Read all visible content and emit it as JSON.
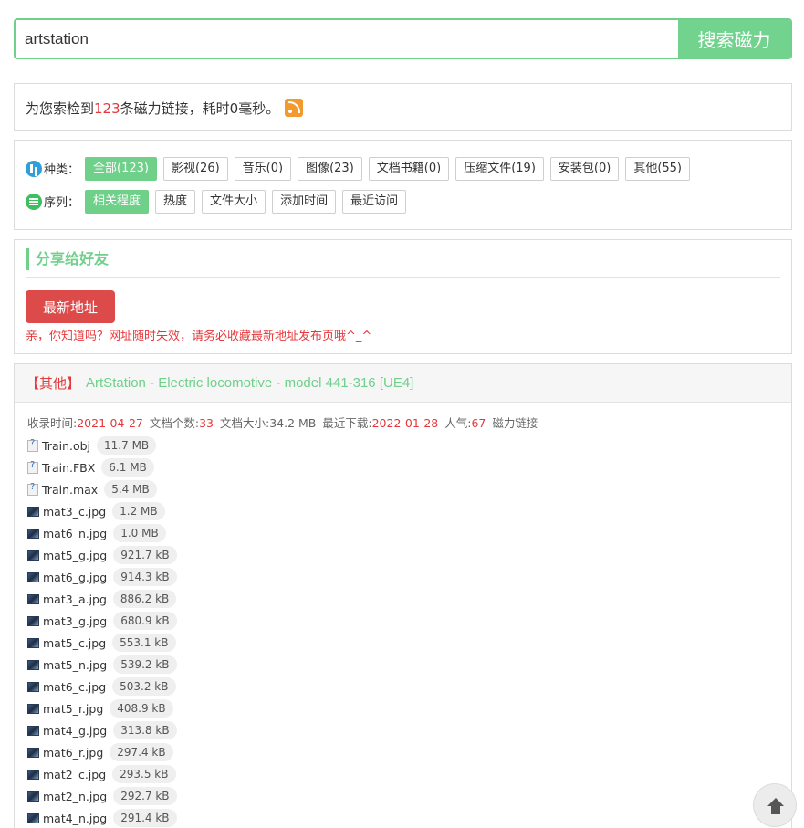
{
  "search": {
    "query": "artstation",
    "button_label": "搜索磁力"
  },
  "summary": {
    "prefix": "为您索检到",
    "count": "123",
    "suffix": "条磁力链接，耗时0毫秒。"
  },
  "filters": {
    "kind_label": "种类：",
    "kinds": [
      "全部(123)",
      "影视(26)",
      "音乐(0)",
      "图像(23)",
      "文档书籍(0)",
      "压缩文件(19)",
      "安装包(0)",
      "其他(55)"
    ],
    "sort_label": "序列：",
    "sorts": [
      "相关程度",
      "热度",
      "文件大小",
      "添加时间",
      "最近访问"
    ]
  },
  "share": {
    "title": "分享给好友",
    "button_label": "最新地址",
    "notice": "亲，你知道吗？网址随时失效，请务必收藏最新地址发布页哦^_^"
  },
  "result": {
    "category": "【其他】",
    "title": "ArtStation - Electric locomotive - model 441-316 [UE4]",
    "meta": {
      "date_label": "收录时间:",
      "date": "2021-04-27",
      "files_label": "文档个数:",
      "files": "33",
      "size_label": "文档大小:",
      "size": "34.2 MB",
      "last_label": "最近下载:",
      "last": "2022-01-28",
      "pop_label": "人气:",
      "pop": "67",
      "magnet_label": "磁力链接"
    },
    "files": [
      {
        "name": "Train.obj",
        "size": "11.7 MB",
        "icon": "unknown-file-icon"
      },
      {
        "name": "Train.FBX",
        "size": "6.1 MB",
        "icon": "unknown-file-icon"
      },
      {
        "name": "Train.max",
        "size": "5.4 MB",
        "icon": "unknown-file-icon"
      },
      {
        "name": "mat3_c.jpg",
        "size": "1.2 MB",
        "icon": "image-file-icon"
      },
      {
        "name": "mat6_n.jpg",
        "size": "1.0 MB",
        "icon": "image-file-icon"
      },
      {
        "name": "mat5_g.jpg",
        "size": "921.7 kB",
        "icon": "image-file-icon"
      },
      {
        "name": "mat6_g.jpg",
        "size": "914.3 kB",
        "icon": "image-file-icon"
      },
      {
        "name": "mat3_a.jpg",
        "size": "886.2 kB",
        "icon": "image-file-icon"
      },
      {
        "name": "mat3_g.jpg",
        "size": "680.9 kB",
        "icon": "image-file-icon"
      },
      {
        "name": "mat5_c.jpg",
        "size": "553.1 kB",
        "icon": "image-file-icon"
      },
      {
        "name": "mat5_n.jpg",
        "size": "539.2 kB",
        "icon": "image-file-icon"
      },
      {
        "name": "mat6_c.jpg",
        "size": "503.2 kB",
        "icon": "image-file-icon"
      },
      {
        "name": "mat5_r.jpg",
        "size": "408.9 kB",
        "icon": "image-file-icon"
      },
      {
        "name": "mat4_g.jpg",
        "size": "313.8 kB",
        "icon": "image-file-icon"
      },
      {
        "name": "mat6_r.jpg",
        "size": "297.4 kB",
        "icon": "image-file-icon"
      },
      {
        "name": "mat2_c.jpg",
        "size": "293.5 kB",
        "icon": "image-file-icon"
      },
      {
        "name": "mat2_n.jpg",
        "size": "292.7 kB",
        "icon": "image-file-icon"
      },
      {
        "name": "mat4_n.jpg",
        "size": "291.4 kB",
        "icon": "image-file-icon"
      }
    ]
  },
  "colors": {
    "accent": "#6fd08a",
    "alert": "#e5383b",
    "button_red": "#dd4a4a"
  }
}
